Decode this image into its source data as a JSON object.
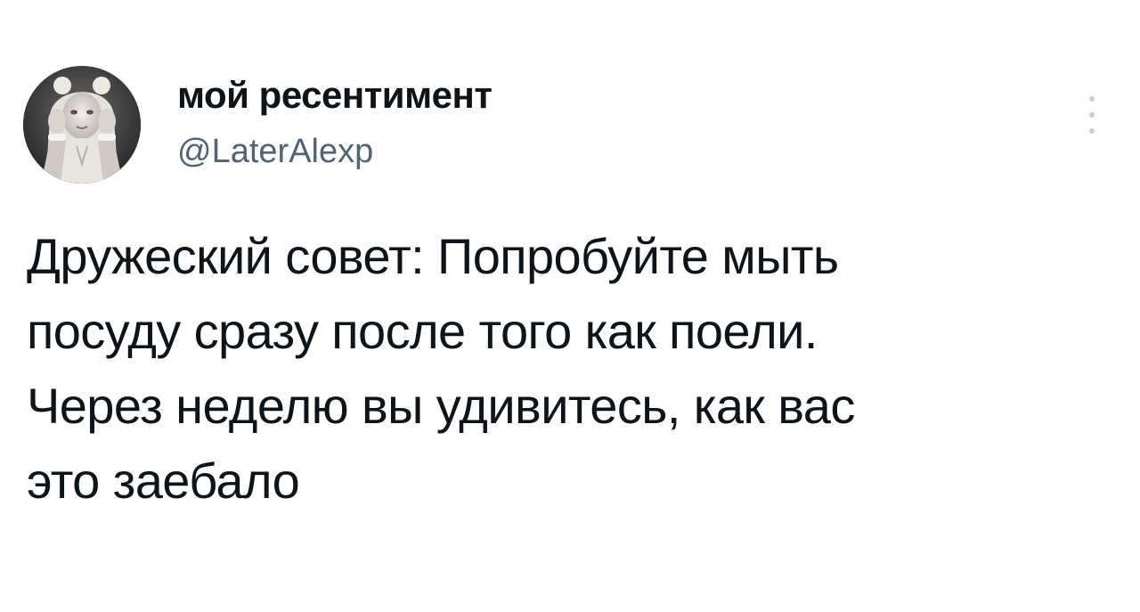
{
  "author": {
    "display_name": "мой ресентимент",
    "handle": "@LaterAlexp",
    "avatar_icon": "profile-photo"
  },
  "menu": {
    "icon": "more-vertical-icon"
  },
  "tweet": {
    "lines": [
      "Дружеский совет: Попробуйте мыть",
      "посуду сразу после того как поели.",
      "Через неделю вы удивитесь, как вас",
      "это заебало"
    ]
  },
  "colors": {
    "text_primary": "#0f1419",
    "text_secondary": "#536471",
    "menu_dots": "#c9ced2",
    "background": "#ffffff"
  }
}
